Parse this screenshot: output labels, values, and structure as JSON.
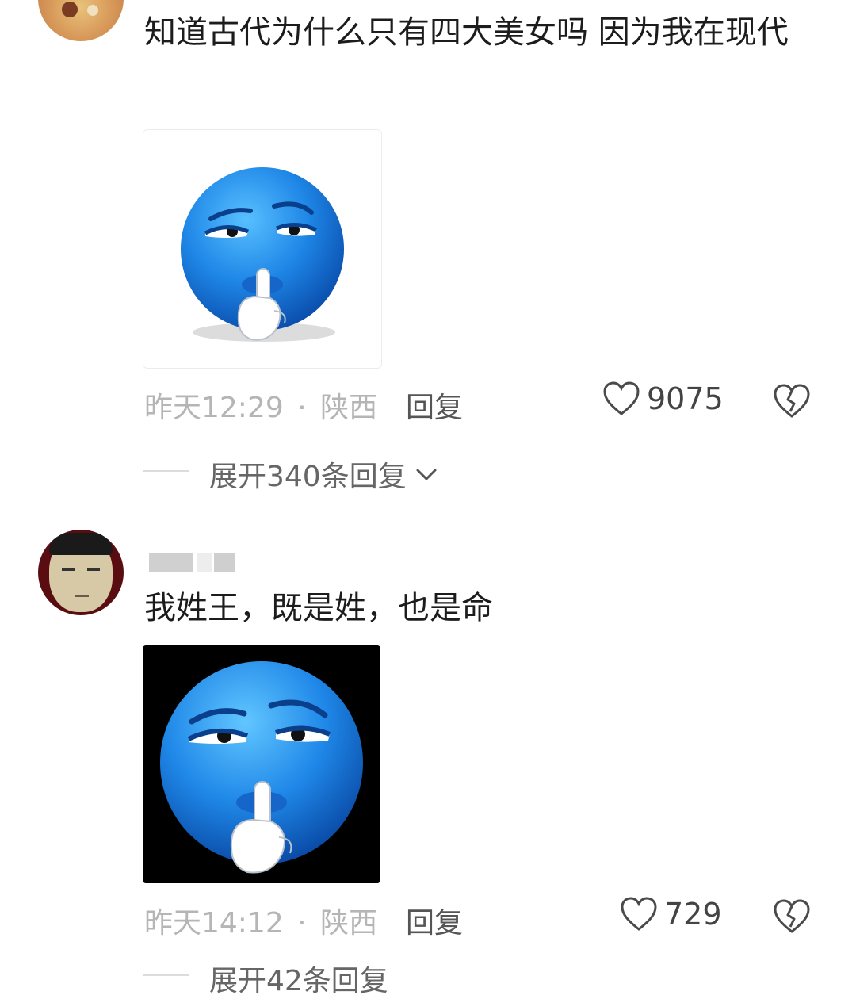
{
  "comments": [
    {
      "text": "知道古代为什么只有四大美女吗 因为我在现代",
      "time": "昨天12:29",
      "location": "陕西",
      "sep": "·",
      "reply_label": "回复",
      "likes": "9075",
      "expand_label": "展开340条回复"
    },
    {
      "text": "我姓王，既是姓，也是命",
      "time": "昨天14:12",
      "location": "陕西",
      "sep": "·",
      "reply_label": "回复",
      "likes": "729",
      "expand_label": "展开42条回复"
    }
  ],
  "icons": {
    "like": "heart-outline-icon",
    "dislike": "broken-heart-icon",
    "expand": "chevron-down-icon"
  },
  "colors": {
    "text": "#1c1c1c",
    "meta": "#b5b5b5",
    "emoji_blue": "#1e86e6",
    "image2_bg": "#000000"
  }
}
